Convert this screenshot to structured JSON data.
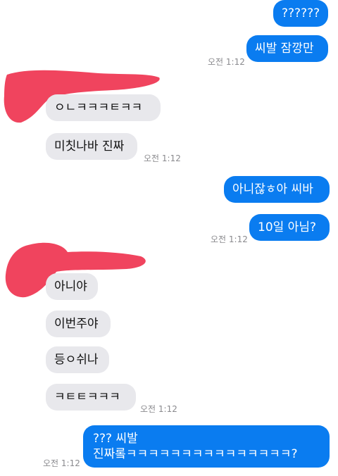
{
  "messages": {
    "m1": "??????",
    "m2": "씨발 잠깡만",
    "m3": "ㅇㄴㅋㅋㅋㅌㅋㅋ",
    "m4": "미칫나바 진짜",
    "m5": "아니잖ㅎ아 씨바",
    "m6": "10일 아님?",
    "m7": "아니야",
    "m8": "이번주야",
    "m9": "등ㅇ쉬나",
    "m10": "ㅋㅌㅌㅋㅋㅋ",
    "m11_line1": "??? 씨발",
    "m11_line2": "진짜롴ㅋㅋㅋㅋㅋㅋㅋㅋㅋㅋㅋㅋㅋㅋㅋ?"
  },
  "timestamps": {
    "t1": "오전 1:12",
    "t2": "오전 1:12",
    "t3": "오전 1:12",
    "t4": "오전 1:12",
    "t5": "오전 1:12"
  },
  "colors": {
    "outgoing_bubble": "#0a7cf0",
    "incoming_bubble": "#e8e8ec",
    "redaction": "#f0445e"
  }
}
